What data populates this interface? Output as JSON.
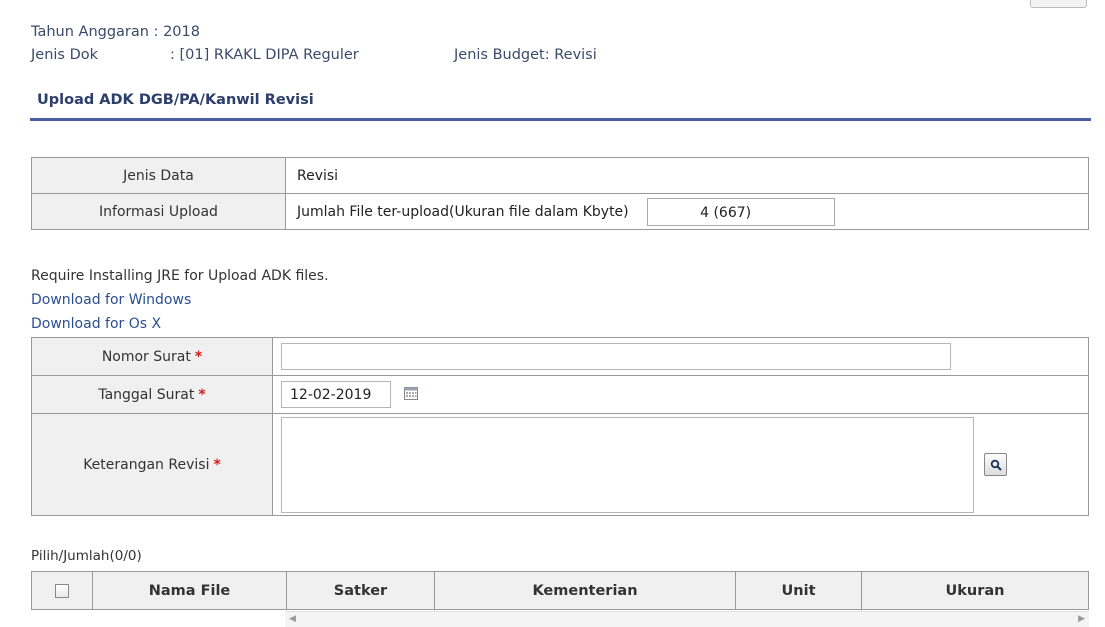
{
  "header": {
    "tahun_label": "Tahun Anggaran : 2018",
    "jenis_dok_label": "Jenis Dok",
    "jenis_dok_value": ": [01] RKAKL DIPA Reguler",
    "jenis_budget": "Jenis Budget: Revisi"
  },
  "section_title": "Upload ADK DGB/PA/Kanwil Revisi",
  "info_table": {
    "jenis_data_label": "Jenis Data",
    "jenis_data_value": "Revisi",
    "informasi_label": "Informasi Upload",
    "informasi_text": "Jumlah File ter-upload(Ukuran file dalam Kbyte)",
    "count_value": "4  (667)"
  },
  "jre": {
    "note": "Require Installing JRE for Upload ADK files.",
    "download_windows": "Download for Windows",
    "download_osx": "Download for Os X"
  },
  "form": {
    "nomor_surat_label": "Nomor Surat",
    "nomor_surat_value": "",
    "tanggal_surat_label": "Tanggal Surat",
    "tanggal_surat_value": "12-02-2019",
    "keterangan_label": "Keterangan Revisi",
    "keterangan_value": "",
    "required_mark": "*"
  },
  "file_table": {
    "pilih_jumlah": "Pilih/Jumlah(0/0)",
    "columns": [
      "Nama File",
      "Satker",
      "Kementerian",
      "Unit",
      "Ukuran"
    ]
  }
}
